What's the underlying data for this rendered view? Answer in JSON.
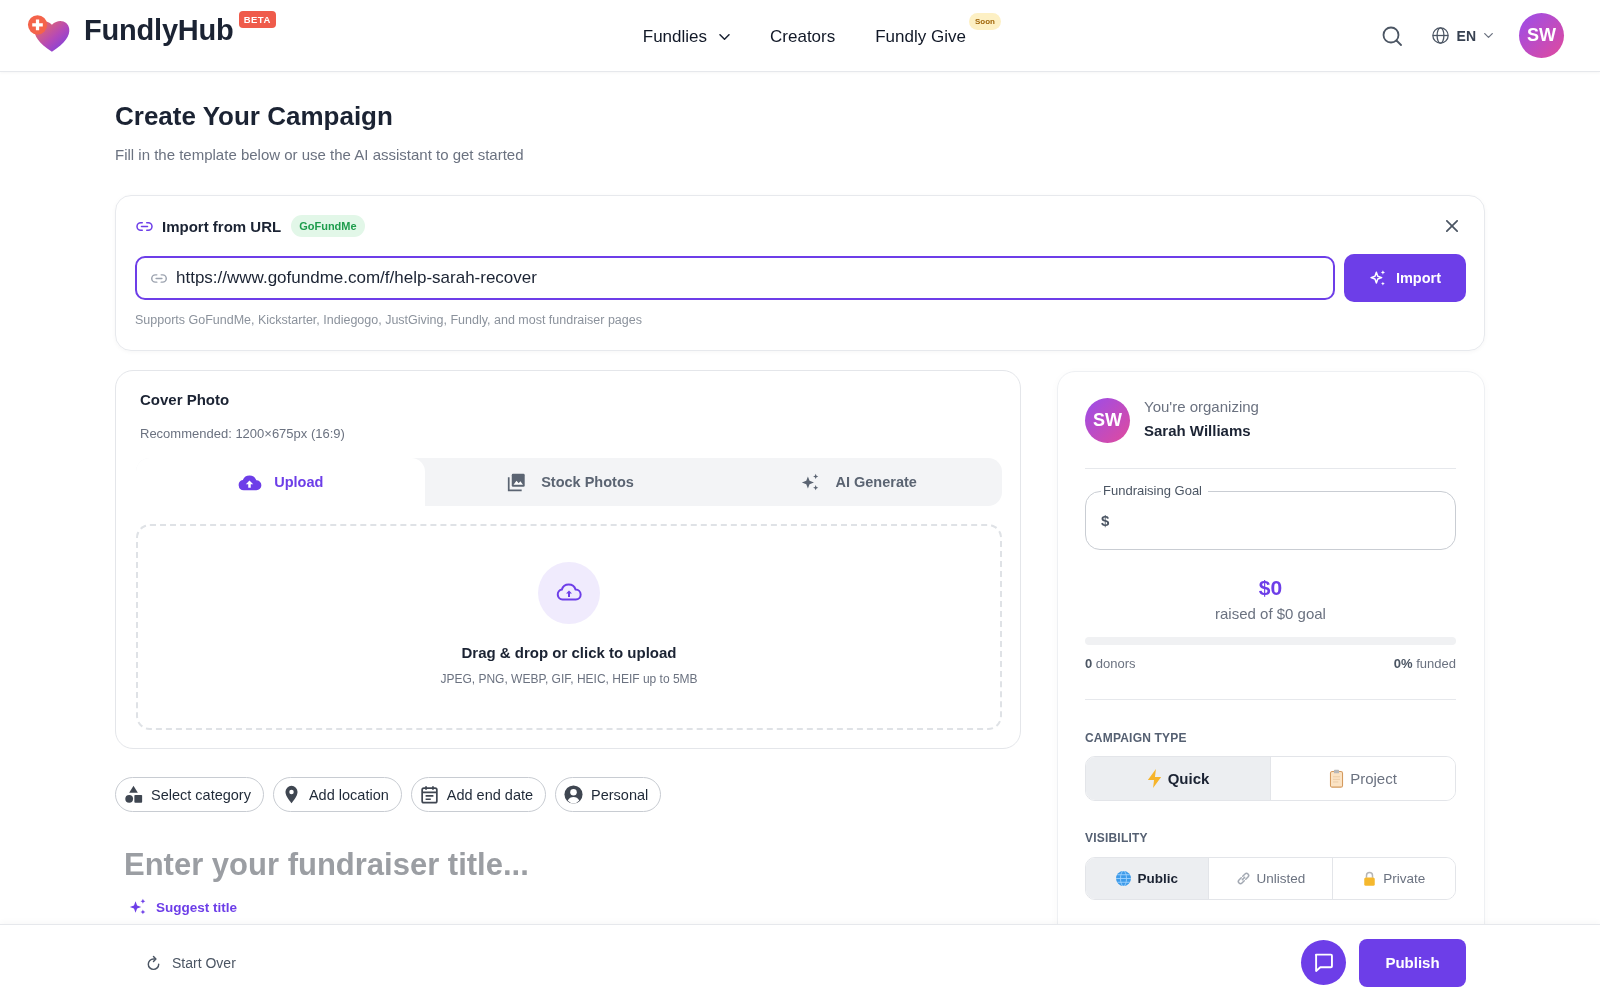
{
  "header": {
    "brand": {
      "name": "FundlyHub",
      "badge": "BETA"
    },
    "nav": [
      {
        "label": "Fundlies",
        "kind": "dropdown"
      },
      {
        "label": "Creators",
        "kind": "link"
      },
      {
        "label": "Fundly Give",
        "kind": "link",
        "badge": "Soon"
      }
    ],
    "language": "EN",
    "avatar": "SW"
  },
  "page": {
    "title": "Create Your Campaign",
    "subtitle": "Fill in the template below or use the AI assistant to get started"
  },
  "import_panel": {
    "title": "Import from URL",
    "badge": "GoFundMe",
    "url": "https://www.gofundme.com/f/help-sarah-recover",
    "button": "Import",
    "hint": "Supports GoFundMe, Kickstarter, Indiegogo, JustGiving, Fundly, and most fundraiser pages"
  },
  "cover_photo": {
    "title": "Cover Photo",
    "recommendation": "Recommended: 1200×675px (16:9)",
    "tabs": [
      {
        "label": "Upload",
        "kind": "upload",
        "selected": true
      },
      {
        "label": "Stock Photos",
        "kind": "stock",
        "selected": false
      },
      {
        "label": "AI Generate",
        "kind": "ai",
        "selected": false
      }
    ],
    "dropzone": {
      "title": "Drag & drop or click to upload",
      "formats": "JPEG, PNG, WEBP, GIF, HEIC, HEIF up to 5MB"
    }
  },
  "chips": [
    {
      "label": "Select category",
      "kind": "category"
    },
    {
      "label": "Add location",
      "kind": "location"
    },
    {
      "label": "Add end date",
      "kind": "date"
    },
    {
      "label": "Personal",
      "kind": "person"
    }
  ],
  "title_field": {
    "placeholder": "Enter your fundraiser title...",
    "suggest": "Suggest title"
  },
  "organizer": {
    "avatar": "SW",
    "caption": "You're organizing",
    "name": "Sarah Williams"
  },
  "goal": {
    "label": "Fundraising Goal",
    "currency": "$",
    "raised": "$0",
    "raised_caption": "raised of $0 goal",
    "level": 0,
    "donors": "**0** donors",
    "funded": "**0%** funded"
  },
  "campaign_type": {
    "label": "CAMPAIGN TYPE",
    "options": [
      {
        "label": "Quick",
        "kind": "quick",
        "selected": true
      },
      {
        "label": "Project",
        "kind": "project",
        "selected": false
      }
    ]
  },
  "visibility": {
    "label": "VISIBILITY",
    "options": [
      {
        "label": "Public",
        "kind": "public",
        "selected": true
      },
      {
        "label": "Unlisted",
        "kind": "unlisted",
        "selected": false
      },
      {
        "label": "Private",
        "kind": "private",
        "selected": false
      }
    ]
  },
  "footer": {
    "start_over": "Start Over",
    "publish": "Publish"
  }
}
